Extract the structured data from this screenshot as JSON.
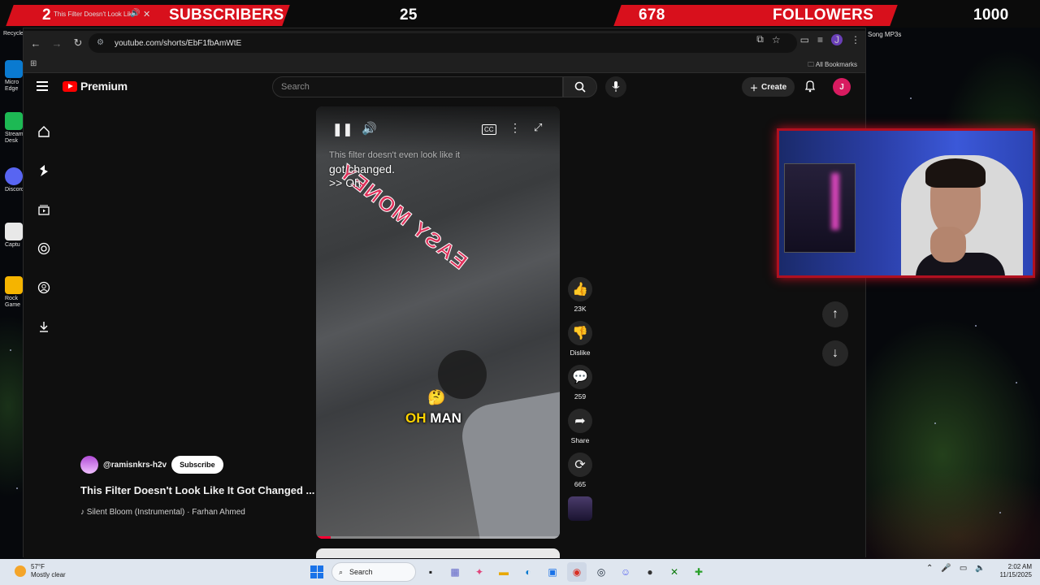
{
  "overlay": {
    "left_count": "2",
    "tab_title": "This Filter Doesn't Look Lik",
    "subscribers_label": "SUBSCRIBERS",
    "subscribers_value": "25",
    "followers_left": "678",
    "followers_label": "FOLLOWERS",
    "followers_value": "1000",
    "accent_color": "#d8101c"
  },
  "browser": {
    "url": "youtube.com/shorts/EbF1fbAmWtE",
    "profile_initial": "J",
    "bookmarks_label": "All Bookmarks"
  },
  "youtube": {
    "logo_text": "Premium",
    "search_placeholder": "Search",
    "create_label": "Create",
    "user_initial": "J",
    "caption_line1": "This filter doesn't even look like it",
    "caption_line2": "got changed.",
    "caption_line3": ">> Oh",
    "decal_text": "EASY MONEY",
    "overlay_text_1": "OH",
    "overlay_text_2": "MAN",
    "channel_handle": "@ramisnkrs-h2v",
    "subscribe_label": "Subscribe",
    "video_title": "This Filter Doesn't Look Like It Got Changed ...",
    "music": "Silent Bloom (Instrumental) · Farhan Ahmed",
    "likes": "23K",
    "dislike_label": "Dislike",
    "comments": "259",
    "share_label": "Share",
    "remixes": "665",
    "progress": 0.06
  },
  "desktop": {
    "icons": [
      "Recycle",
      "Micro Edge",
      "Stream Desk",
      "Discord",
      "Captu",
      "Rock Game"
    ],
    "right_icon": "Song MP3s"
  },
  "taskbar": {
    "temperature": "57°F",
    "weather": "Mostly clear",
    "search_label": "Search",
    "time": "2:02 AM",
    "date": "11/15/2025"
  }
}
